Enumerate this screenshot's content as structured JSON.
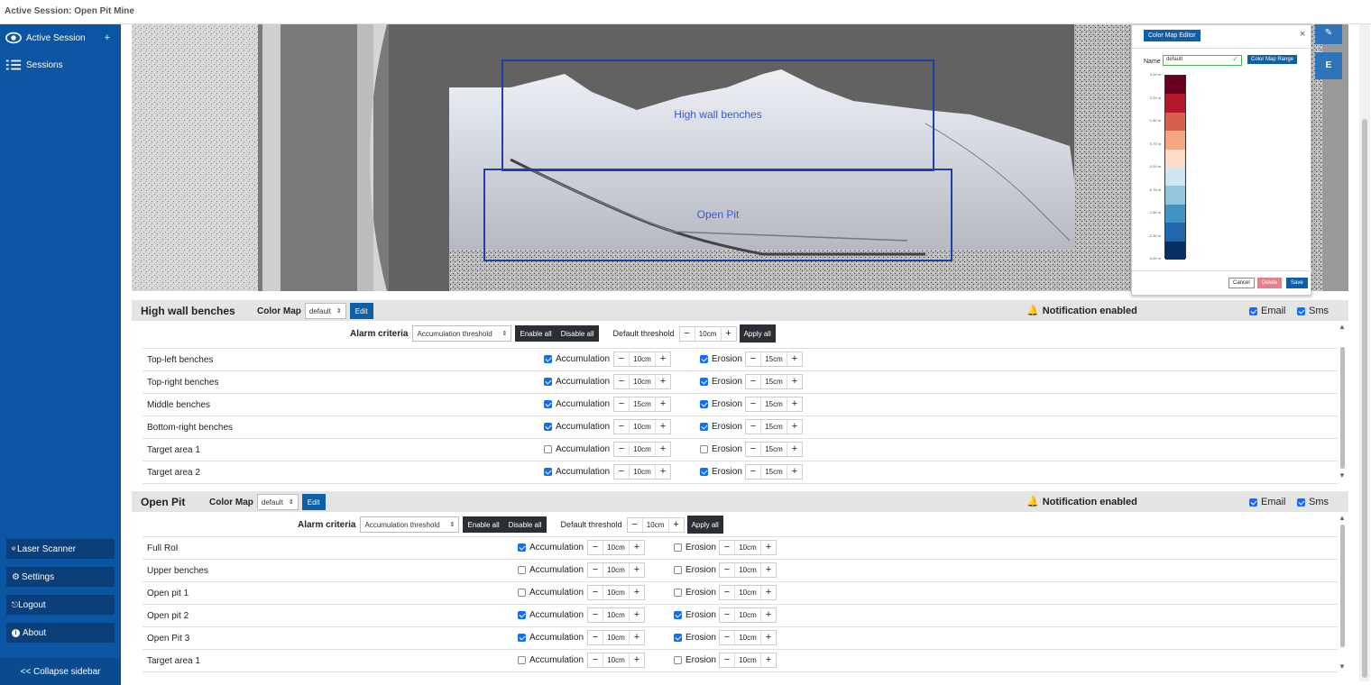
{
  "window": {
    "title": "Active Session: Open Pit Mine"
  },
  "sidebar": {
    "items": [
      {
        "label": "Active Session",
        "icon": "eye-icon",
        "action": "+"
      },
      {
        "label": "Sessions",
        "icon": "list-icon"
      }
    ],
    "bottom": [
      {
        "label": "Laser Scanner",
        "icon": "scanner-icon"
      },
      {
        "label": "Settings",
        "icon": "gear-icon"
      },
      {
        "label": "Logout",
        "icon": "logout-icon"
      },
      {
        "label": "About",
        "icon": "info-icon"
      }
    ],
    "collapse_label": "<< Collapse sidebar"
  },
  "viewer": {
    "regions": [
      {
        "label": "High wall benches"
      },
      {
        "label": "Open Pit"
      }
    ],
    "side_buttons": [
      {
        "label": "",
        "icon": "pencil-icon"
      },
      {
        "label": "E"
      }
    ]
  },
  "color_map_editor": {
    "title": "Color Map Editor",
    "close": "×",
    "name_label": "Name",
    "name_value": "default",
    "range_button": "Color Map Range",
    "scale_colors": [
      "#67001f",
      "#b2182b",
      "#d6604d",
      "#f4a582",
      "#fddbc7",
      "#d1e5f0",
      "#92c5de",
      "#4393c3",
      "#2166ac",
      "#053061"
    ],
    "tick_labels": [
      "3.00 m",
      "2.25 m",
      "1.50 m",
      "0.75 m",
      "0.00 m",
      "-0.75 m",
      "-1.50 m",
      "-2.25 m",
      "-3.00 m"
    ],
    "cancel": "Cancel",
    "delete": "Delete",
    "save": "Save"
  },
  "panels": [
    {
      "title": "High wall benches",
      "color_map_label": "Color Map",
      "color_map_value": "default",
      "edit": "Edit",
      "notification": "Notification enabled",
      "email": "Email",
      "sms": "Sms",
      "alarm_label": "Alarm criteria",
      "alarm_value": "Accumulation threshold",
      "enable_all": "Enable all",
      "disable_all": "Disable all",
      "default_threshold_label": "Default threshold",
      "default_threshold_value": "10cm",
      "apply_all": "Apply all",
      "rows": [
        {
          "name": "Top-left benches",
          "acc_on": true,
          "acc": "10cm",
          "ero_on": true,
          "ero": "15cm"
        },
        {
          "name": "Top-right benches",
          "acc_on": true,
          "acc": "10cm",
          "ero_on": true,
          "ero": "15cm"
        },
        {
          "name": "Middle benches",
          "acc_on": true,
          "acc": "15cm",
          "ero_on": true,
          "ero": "15cm"
        },
        {
          "name": "Bottom-right benches",
          "acc_on": true,
          "acc": "10cm",
          "ero_on": true,
          "ero": "15cm"
        },
        {
          "name": "Target area 1",
          "acc_on": false,
          "acc": "10cm",
          "ero_on": false,
          "ero": "15cm"
        },
        {
          "name": "Target area 2",
          "acc_on": true,
          "acc": "10cm",
          "ero_on": true,
          "ero": "15cm"
        }
      ]
    },
    {
      "title": "Open Pit",
      "color_map_label": "Color Map",
      "color_map_value": "default",
      "edit": "Edit",
      "notification": "Notification enabled",
      "email": "Email",
      "sms": "Sms",
      "alarm_label": "Alarm criteria",
      "alarm_value": "Accumulation threshold",
      "enable_all": "Enable all",
      "disable_all": "Disable all",
      "default_threshold_label": "Default threshold",
      "default_threshold_value": "10cm",
      "apply_all": "Apply all",
      "rows": [
        {
          "name": "Full RoI",
          "acc_on": true,
          "acc": "10cm",
          "ero_on": false,
          "ero": "10cm"
        },
        {
          "name": "Upper benches",
          "acc_on": false,
          "acc": "10cm",
          "ero_on": false,
          "ero": "10cm"
        },
        {
          "name": "Open pit 1",
          "acc_on": false,
          "acc": "10cm",
          "ero_on": false,
          "ero": "10cm"
        },
        {
          "name": "Open pit 2",
          "acc_on": true,
          "acc": "10cm",
          "ero_on": true,
          "ero": "10cm"
        },
        {
          "name": "Open Pit 3",
          "acc_on": true,
          "acc": "10cm",
          "ero_on": true,
          "ero": "10cm"
        },
        {
          "name": "Target area 1",
          "acc_on": false,
          "acc": "10cm",
          "ero_on": false,
          "ero": "10cm"
        }
      ]
    }
  ],
  "labels": {
    "accumulation": "Accumulation",
    "erosion": "Erosion",
    "minus": "−",
    "plus": "+"
  }
}
